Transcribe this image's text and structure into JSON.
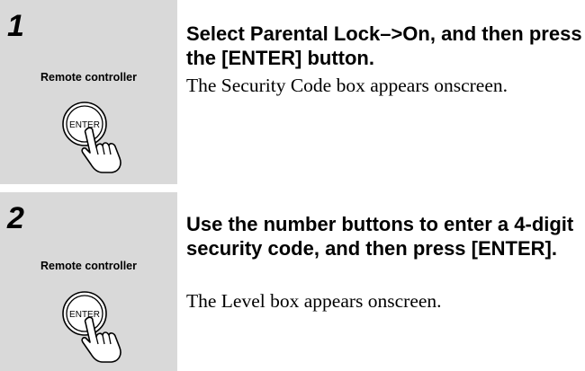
{
  "steps": [
    {
      "number": "1",
      "remote_label": "Remote controller",
      "button_label": "ENTER",
      "heading": "Select Parental Lock–>On, and then press the [ENTER] button.",
      "description": "The Security Code box appears onscreen."
    },
    {
      "number": "2",
      "remote_label": "Remote controller",
      "button_label": "ENTER",
      "heading": "Use the number buttons to enter a 4-digit security code, and then press [ENTER].",
      "description": "The Level box appears onscreen."
    }
  ],
  "colors": {
    "left_panel": "#d9d9d9",
    "text": "#000000"
  }
}
